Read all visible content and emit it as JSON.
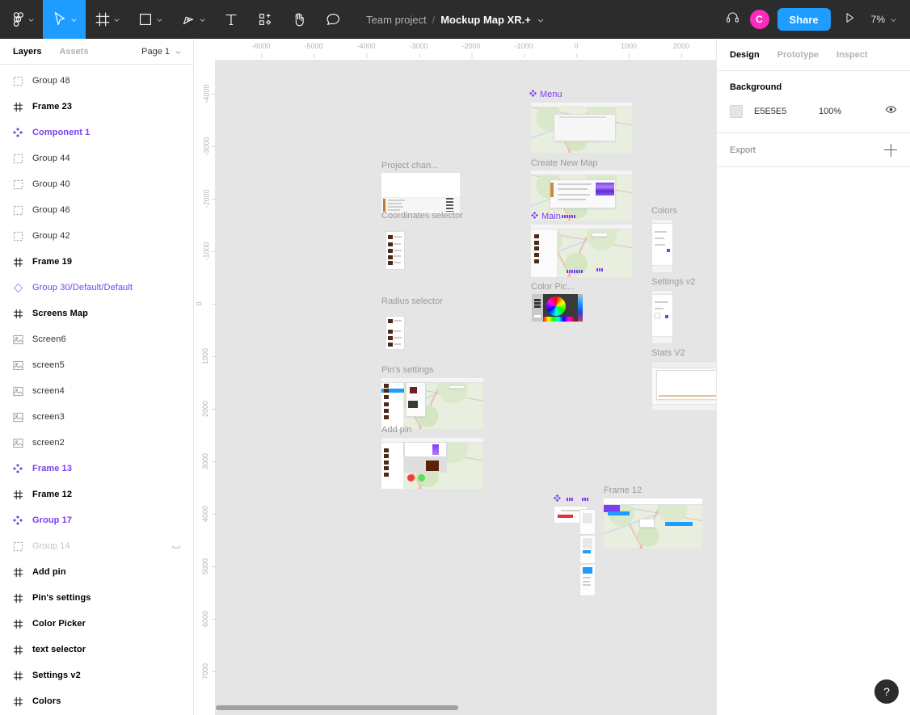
{
  "toolbar": {
    "tools": [
      {
        "name": "figma-logo-icon",
        "label": "Figma menu",
        "caret": true,
        "active": false
      },
      {
        "name": "move-tool-icon",
        "label": "Move",
        "caret": true,
        "active": true
      },
      {
        "name": "frame-tool-icon",
        "label": "Frame",
        "caret": true,
        "active": false
      },
      {
        "name": "shape-tool-icon",
        "label": "Rectangle",
        "caret": true,
        "active": false
      },
      {
        "name": "pen-tool-icon",
        "label": "Pen",
        "caret": true,
        "active": false
      },
      {
        "name": "text-tool-icon",
        "label": "Text",
        "caret": false,
        "active": false
      },
      {
        "name": "resources-icon",
        "label": "Resources",
        "caret": false,
        "active": false
      },
      {
        "name": "hand-tool-icon",
        "label": "Hand",
        "caret": false,
        "active": false
      },
      {
        "name": "comment-tool-icon",
        "label": "Comment",
        "caret": false,
        "active": false
      }
    ],
    "breadcrumb_team": "Team project",
    "breadcrumb_separator": "/",
    "breadcrumb_file": "Mockup Map XR.+",
    "headphones_icon": "headphones-icon",
    "avatar_initial": "C",
    "share_label": "Share",
    "present_icon": "present-play-icon",
    "zoom_level": "7%"
  },
  "left_panel": {
    "tabs": [
      {
        "label": "Layers",
        "active": true
      },
      {
        "label": "Assets",
        "active": false
      }
    ],
    "page_selector": "Page 1",
    "layers": [
      {
        "label": "Group 48",
        "icon": "group-icon",
        "style": "normal"
      },
      {
        "label": "Frame 23",
        "icon": "frame-icon",
        "style": "bold"
      },
      {
        "label": "Component 1",
        "icon": "component-icon",
        "style": "component"
      },
      {
        "label": "Group 44",
        "icon": "group-icon",
        "style": "normal"
      },
      {
        "label": "Group 40",
        "icon": "group-icon",
        "style": "normal"
      },
      {
        "label": "Group 46",
        "icon": "group-icon",
        "style": "normal"
      },
      {
        "label": "Group 42",
        "icon": "group-icon",
        "style": "normal"
      },
      {
        "label": "Frame 19",
        "icon": "frame-icon",
        "style": "bold"
      },
      {
        "label": "Group 30/Default/Default",
        "icon": "variant-icon",
        "style": "instance"
      },
      {
        "label": "Screens Map",
        "icon": "frame-icon",
        "style": "bold"
      },
      {
        "label": "Screen6",
        "icon": "image-icon",
        "style": "normal"
      },
      {
        "label": "screen5",
        "icon": "image-icon",
        "style": "normal"
      },
      {
        "label": "screen4",
        "icon": "image-icon",
        "style": "normal"
      },
      {
        "label": "screen3",
        "icon": "image-icon",
        "style": "normal"
      },
      {
        "label": "screen2",
        "icon": "image-icon",
        "style": "normal"
      },
      {
        "label": "Frame 13",
        "icon": "component-icon",
        "style": "component"
      },
      {
        "label": "Frame 12",
        "icon": "frame-icon",
        "style": "bold"
      },
      {
        "label": "Group 17",
        "icon": "component-icon",
        "style": "component"
      },
      {
        "label": "Group 14",
        "icon": "group-icon",
        "style": "hidden",
        "hidden_icon": "eye-closed-icon"
      },
      {
        "label": "Add pin",
        "icon": "frame-icon",
        "style": "bold"
      },
      {
        "label": "Pin's settings",
        "icon": "frame-icon",
        "style": "bold"
      },
      {
        "label": "Color Picker",
        "icon": "frame-icon",
        "style": "bold"
      },
      {
        "label": "text selector",
        "icon": "frame-icon",
        "style": "bold"
      },
      {
        "label": "Settings v2",
        "icon": "frame-icon",
        "style": "bold"
      },
      {
        "label": "Colors",
        "icon": "frame-icon",
        "style": "bold"
      }
    ]
  },
  "canvas": {
    "ruler_h_ticks": [
      "-6000",
      "-5000",
      "-4000",
      "-3000",
      "-2000",
      "-1000",
      "0",
      "1000",
      "2000"
    ],
    "ruler_v_ticks": [
      "-4000",
      "-3000",
      "-2000",
      "-1000",
      "0",
      "1000",
      "2000",
      "3000",
      "4000",
      "5000",
      "6000",
      "7000"
    ],
    "frames": [
      {
        "label": "Menu",
        "type": "component"
      },
      {
        "label": "Create New Map",
        "type": "frame"
      },
      {
        "label": "Project chan...",
        "type": "frame"
      },
      {
        "label": "Main",
        "type": "component"
      },
      {
        "label": "Colors",
        "type": "frame"
      },
      {
        "label": "Coordinates selector",
        "type": "frame"
      },
      {
        "label": "Settings v2",
        "type": "frame"
      },
      {
        "label": "Color Pic...",
        "type": "frame"
      },
      {
        "label": "Radius selector",
        "type": "frame"
      },
      {
        "label": "Stats V2",
        "type": "frame"
      },
      {
        "label": "Pin's settings",
        "type": "frame"
      },
      {
        "label": "Add pin",
        "type": "frame"
      },
      {
        "label": "Frame 12",
        "type": "frame"
      }
    ]
  },
  "right_panel": {
    "tabs": [
      {
        "label": "Design",
        "active": true
      },
      {
        "label": "Prototype",
        "active": false
      },
      {
        "label": "Inspect",
        "active": false
      }
    ],
    "background": {
      "title": "Background",
      "color_hex": "E5E5E5",
      "swatch_color": "#E5E5E5",
      "opacity": "100%",
      "visibility_icon": "eye-open-icon"
    },
    "export": {
      "label": "Export",
      "add_icon": "plus-icon"
    }
  },
  "help": {
    "label": "?"
  }
}
